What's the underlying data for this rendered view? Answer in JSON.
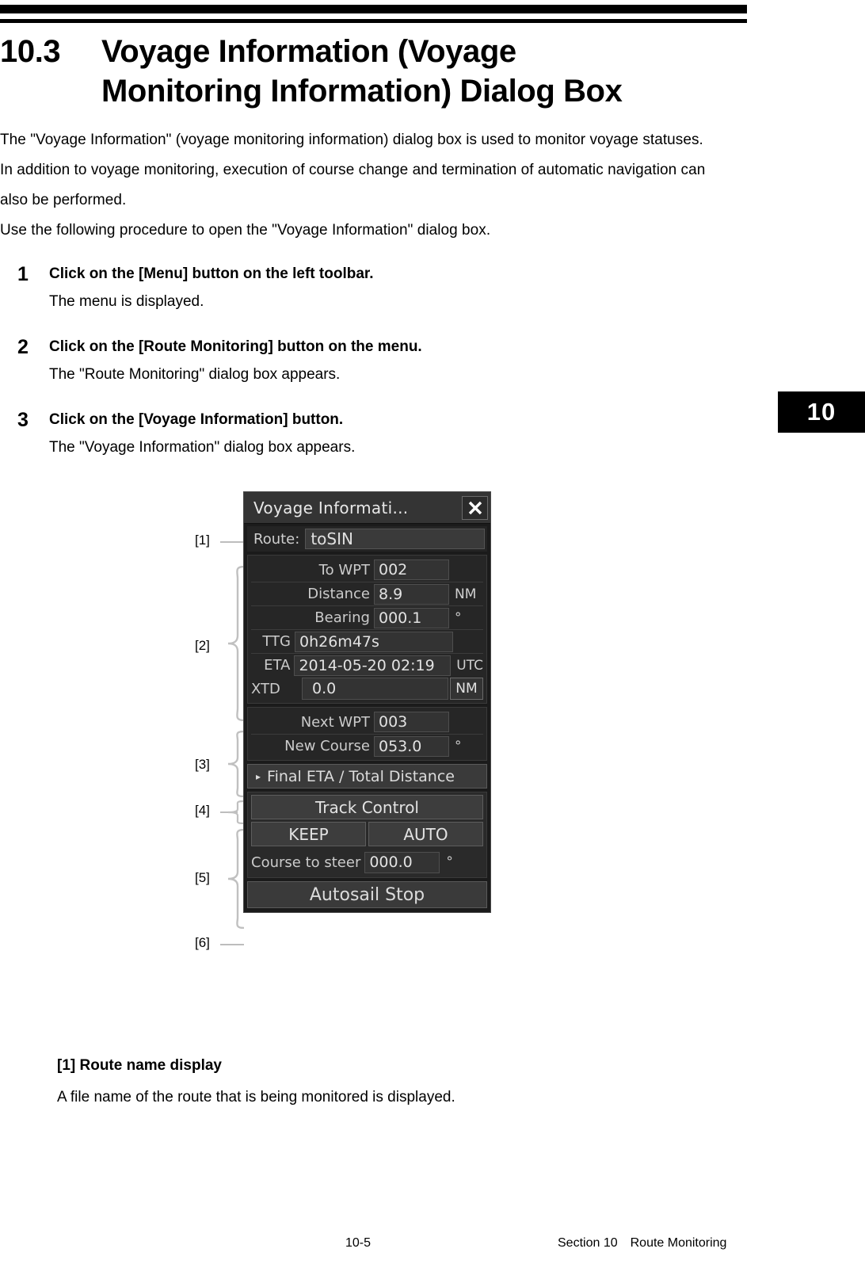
{
  "section_tab": "10",
  "heading": {
    "number": "10.3",
    "line1": "Voyage Information (Voyage",
    "line2": "Monitoring Information) Dialog Box"
  },
  "intro": {
    "p1": "The \"Voyage Information\" (voyage monitoring information) dialog box is used to monitor voyage statuses.",
    "p2": "In addition to voyage monitoring, execution of course change and termination of automatic navigation can also be performed.",
    "p3": "Use the following procedure to open the \"Voyage Information\" dialog box."
  },
  "steps": [
    {
      "number": "1",
      "heading": "Click on the [Menu] button on the left toolbar.",
      "description": "The menu is displayed."
    },
    {
      "number": "2",
      "heading": "Click on the [Route Monitoring] button on the menu.",
      "description": "The \"Route Monitoring\" dialog box appears."
    },
    {
      "number": "3",
      "heading": "Click on the [Voyage Information] button.",
      "description": "The \"Voyage Information\" dialog box appears."
    }
  ],
  "callouts": {
    "c1": "[1]",
    "c2": "[2]",
    "c3": "[3]",
    "c4": "[4]",
    "c5": "[5]",
    "c6": "[6]"
  },
  "dialog": {
    "title": "Voyage Informati...",
    "close_icon": "close-icon",
    "route": {
      "label": "Route:",
      "value": "toSIN"
    },
    "to_wpt": {
      "label": "To WPT",
      "value": "002"
    },
    "distance": {
      "label": "Distance",
      "value": "8.9",
      "unit": "NM"
    },
    "bearing": {
      "label": "Bearing",
      "value": "000.1",
      "unit": "°"
    },
    "ttg": {
      "label": "TTG",
      "value": "0h26m47s"
    },
    "eta": {
      "label": "ETA",
      "value": "2014-05-20 02:19",
      "unit": "UTC"
    },
    "xtd": {
      "label": "XTD",
      "value": "0.0",
      "unit": "NM"
    },
    "next_wpt": {
      "label": "Next WPT",
      "value": "003"
    },
    "new_course": {
      "label": "New Course",
      "value": "053.0",
      "unit": "°"
    },
    "final_eta": {
      "label": "Final ETA / Total Distance",
      "arrow": "▸"
    },
    "track_control": {
      "title": "Track Control",
      "keep": "KEEP",
      "auto": "AUTO",
      "course_to_steer_label": "Course to steer",
      "course_to_steer_value": "000.0",
      "course_to_steer_unit": "°"
    },
    "autosail_stop": "Autosail Stop"
  },
  "explanation": {
    "heading": "[1] Route name display",
    "body": "A file name of the route that is being monitored is displayed."
  },
  "footer": {
    "page": "10-5",
    "section": "Section 10 Route Monitoring"
  }
}
